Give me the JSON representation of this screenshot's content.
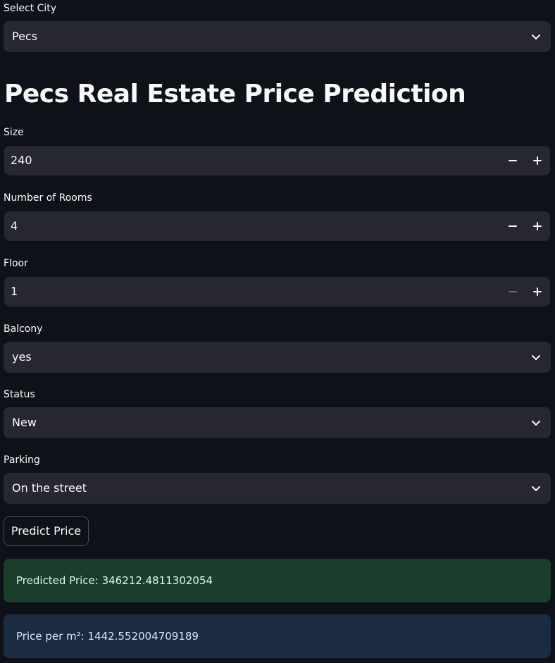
{
  "city": {
    "label": "Select City",
    "value": "Pecs"
  },
  "title": "Pecs Real Estate Price Prediction",
  "size": {
    "label": "Size",
    "value": "240"
  },
  "rooms": {
    "label": "Number of Rooms",
    "value": "4"
  },
  "floor": {
    "label": "Floor",
    "value": "1"
  },
  "balcony": {
    "label": "Balcony",
    "value": "yes"
  },
  "status": {
    "label": "Status",
    "value": "New"
  },
  "parking": {
    "label": "Parking",
    "value": "On the street"
  },
  "predict_button": "Predict Price",
  "results": {
    "predicted_price": "Predicted Price: 346212.4811302054",
    "price_per_m2": "Price per m²: 1442.552004709189"
  },
  "colors": {
    "background": "#0e1117",
    "widget": "#262730",
    "success_bg": "#1b3d2b",
    "info_bg": "#1a2b42"
  }
}
